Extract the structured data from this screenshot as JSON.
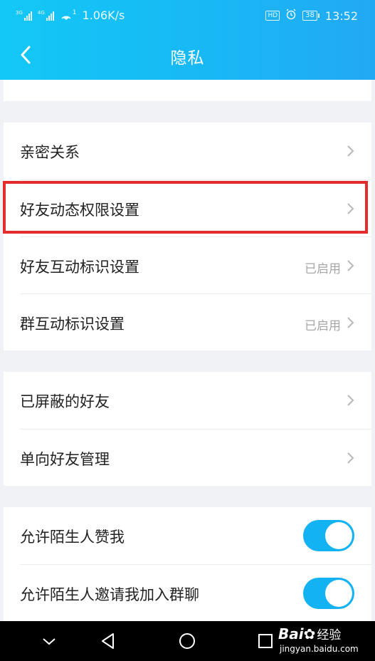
{
  "status_bar": {
    "network_left": "3G",
    "network_right": "4G",
    "hotspot_count": "1",
    "speed": "1.06K/s",
    "hd": "HD",
    "battery": "38",
    "time": "13:52"
  },
  "header": {
    "title": "隐私"
  },
  "sections": {
    "relations": {
      "intimate": {
        "label": "亲密关系"
      },
      "feed_permission": {
        "label": "好友动态权限设置"
      },
      "friend_marks": {
        "label": "好友互动标识设置",
        "value": "已启用"
      },
      "group_marks": {
        "label": "群互动标识设置",
        "value": "已启用"
      }
    },
    "blocking": {
      "blocked": {
        "label": "已屏蔽的好友"
      },
      "one_way": {
        "label": "单向好友管理"
      }
    },
    "strangers": {
      "allow_like": {
        "label": "允许陌生人赞我",
        "enabled": true
      },
      "allow_invite": {
        "label": "允许陌生人邀请我加入群聊",
        "enabled": true
      }
    }
  },
  "watermark": {
    "brand": "Bai",
    "brand_cn": "经验",
    "url": "jingyan.baidu.com"
  },
  "colors": {
    "accent": "#13b2f2",
    "header": "#18b8f5",
    "highlight": "#e52b2b"
  }
}
